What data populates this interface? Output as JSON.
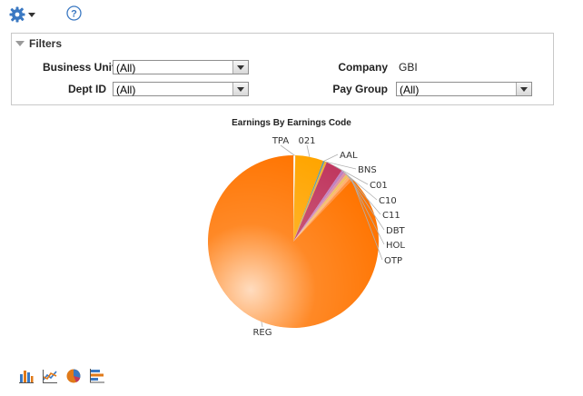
{
  "toolbar": {
    "settings_icon": "gear-icon",
    "help_icon": "help-icon"
  },
  "filters": {
    "title": "Filters",
    "business_unit_label": "Business Unit",
    "business_unit_value": "(All)",
    "company_label": "Company",
    "company_value": "GBI",
    "dept_label": "Dept ID",
    "dept_value": "(All)",
    "pay_group_label": "Pay Group",
    "pay_group_value": "(All)"
  },
  "chart_data": {
    "type": "pie",
    "title": "Earnings By Earnings Code",
    "slices": [
      {
        "label": "TPA",
        "value": 0.4,
        "color": "#ffffff"
      },
      {
        "label": "021",
        "value": 5.3,
        "color": "#ffa500"
      },
      {
        "label": "AAL",
        "value": 0.3,
        "color": "#5a9aa8"
      },
      {
        "label": "BNS",
        "value": 0.4,
        "color": "#f0b030"
      },
      {
        "label": "C01",
        "value": 3.2,
        "color": "#c03860"
      },
      {
        "label": "C10",
        "value": 0.6,
        "color": "#c080c0"
      },
      {
        "label": "C11",
        "value": 0.5,
        "color": "#e090a0"
      },
      {
        "label": "DBT",
        "value": 0.5,
        "color": "#f0c060"
      },
      {
        "label": "HOL",
        "value": 0.5,
        "color": "#ffb070"
      },
      {
        "label": "OTP",
        "value": 0.5,
        "color": "#ff9040"
      },
      {
        "label": "REG",
        "value": 87.8,
        "color": "#ff7400"
      }
    ]
  },
  "chart_icons": [
    "bar-chart-icon",
    "line-chart-icon",
    "pie-chart-icon",
    "horizontal-bar-chart-icon"
  ]
}
